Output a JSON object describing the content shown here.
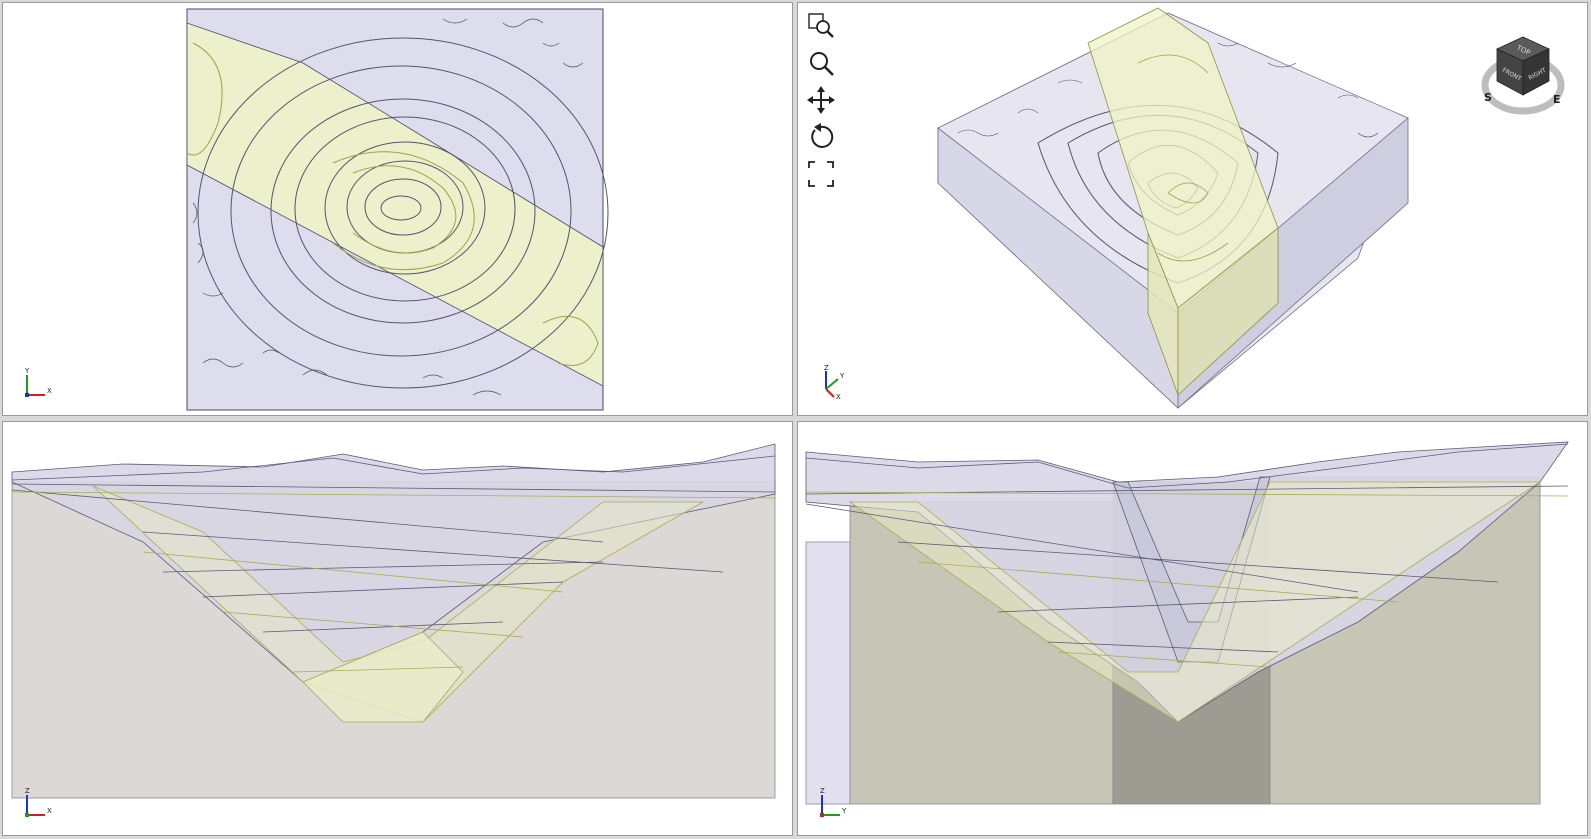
{
  "viewports": {
    "top": {
      "axes": {
        "vertical": "Y",
        "horizontal": "X"
      }
    },
    "perspective": {
      "toolbar": [
        {
          "name": "zoom-window-icon"
        },
        {
          "name": "zoom-icon"
        },
        {
          "name": "pan-icon"
        },
        {
          "name": "rotate-icon"
        },
        {
          "name": "fit-all-icon"
        }
      ],
      "navcube": {
        "top": "TOP",
        "front": "FRONT",
        "right": "RIGHT",
        "compass_s": "S",
        "compass_e": "E"
      },
      "axes": {
        "vertical": "Z",
        "horizontal": "X",
        "depth": "Y"
      }
    },
    "front": {
      "axes": {
        "vertical": "Z",
        "horizontal": "X"
      }
    },
    "side": {
      "axes": {
        "vertical": "Z",
        "horizontal": "Y"
      }
    }
  },
  "colors": {
    "terrain": "#dedded",
    "terrain_line": "#4a4866",
    "fault_plane": "#f0f4c4",
    "fault_line": "#a8ad52",
    "solid_gray": "#c9c7b8",
    "solid_dark": "#9d9c93",
    "frame": "#9a9a9a"
  }
}
